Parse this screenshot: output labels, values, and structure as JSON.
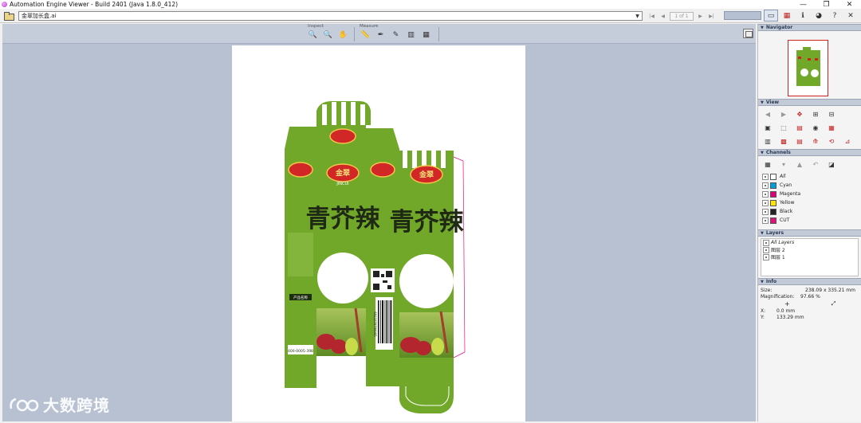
{
  "window": {
    "title": "Automation Engine Viewer - Build 2401 (Java 1.8.0_412)",
    "minimize": "—",
    "maximize": "❐",
    "close": "✕"
  },
  "toolbar": {
    "file_name": "金翠加长盒.ai",
    "page_indicator": "1 of 1",
    "page_first": "|◀",
    "page_prev": "◀",
    "page_next": "▶",
    "page_last": "▶|",
    "combo_arrow": "▼",
    "tool_icons": [
      "view-mode-icon",
      "separations-icon",
      "info-icon",
      "globe-icon",
      "help-icon",
      "close-icon"
    ],
    "tool_glyphs": [
      "▭",
      "▦",
      "ℹ",
      "◕",
      "?",
      "✕"
    ]
  },
  "viewer": {
    "inspect_label": "Inspect",
    "measure_label": "Measure",
    "inspect_tools": [
      "🔍",
      "🔍",
      "✋"
    ],
    "measure_tools": [
      "📏",
      "✒",
      "✎",
      "▥",
      "▦"
    ]
  },
  "artwork": {
    "title_cn": "青芥辣",
    "brand_cn": "金翠",
    "brand_en": "JINCUI",
    "barcode_text": "6922278799995",
    "hotline": "400-0005-398",
    "product_label": "产品名称"
  },
  "panels": {
    "navigator": "Navigator",
    "view": "View",
    "channels": "Channels",
    "layers": "Layers",
    "info": "Info"
  },
  "view_icons": [
    "◀",
    "▶",
    "✥",
    "⊞",
    "⊟",
    "▣",
    "⬚",
    "▤",
    "◉",
    "▦",
    "▥",
    "▩",
    "▤",
    "⟰",
    "⟲",
    "⊿",
    "✛",
    "⁂"
  ],
  "channel_tools": [
    "▦",
    "▾",
    "▲",
    "↶",
    "◪"
  ],
  "channels": [
    {
      "name": "All",
      "color": "#ffffff",
      "italic": true
    },
    {
      "name": "Cyan",
      "color": "#00a0e0",
      "italic": false
    },
    {
      "name": "Magenta",
      "color": "#e0007a",
      "italic": false
    },
    {
      "name": "Yellow",
      "color": "#ffe600",
      "italic": false
    },
    {
      "name": "Black",
      "color": "#222222",
      "italic": false
    },
    {
      "name": "CUT",
      "color": "#e0107a",
      "italic": false
    }
  ],
  "layers": [
    {
      "name": "All Layers",
      "italic": true
    },
    {
      "name": "图层 2",
      "italic": false
    },
    {
      "name": "图层 1",
      "italic": false
    }
  ],
  "info": {
    "size_label": "Size:",
    "size_value": "238.09 x 335.21 mm",
    "mag_label": "Magnification:",
    "mag_value": "97.66 %",
    "x_label": "X:",
    "x_value": "0.0 mm",
    "y_label": "Y:",
    "y_value": "133.29 mm"
  },
  "watermark": {
    "text": "大数跨境"
  }
}
